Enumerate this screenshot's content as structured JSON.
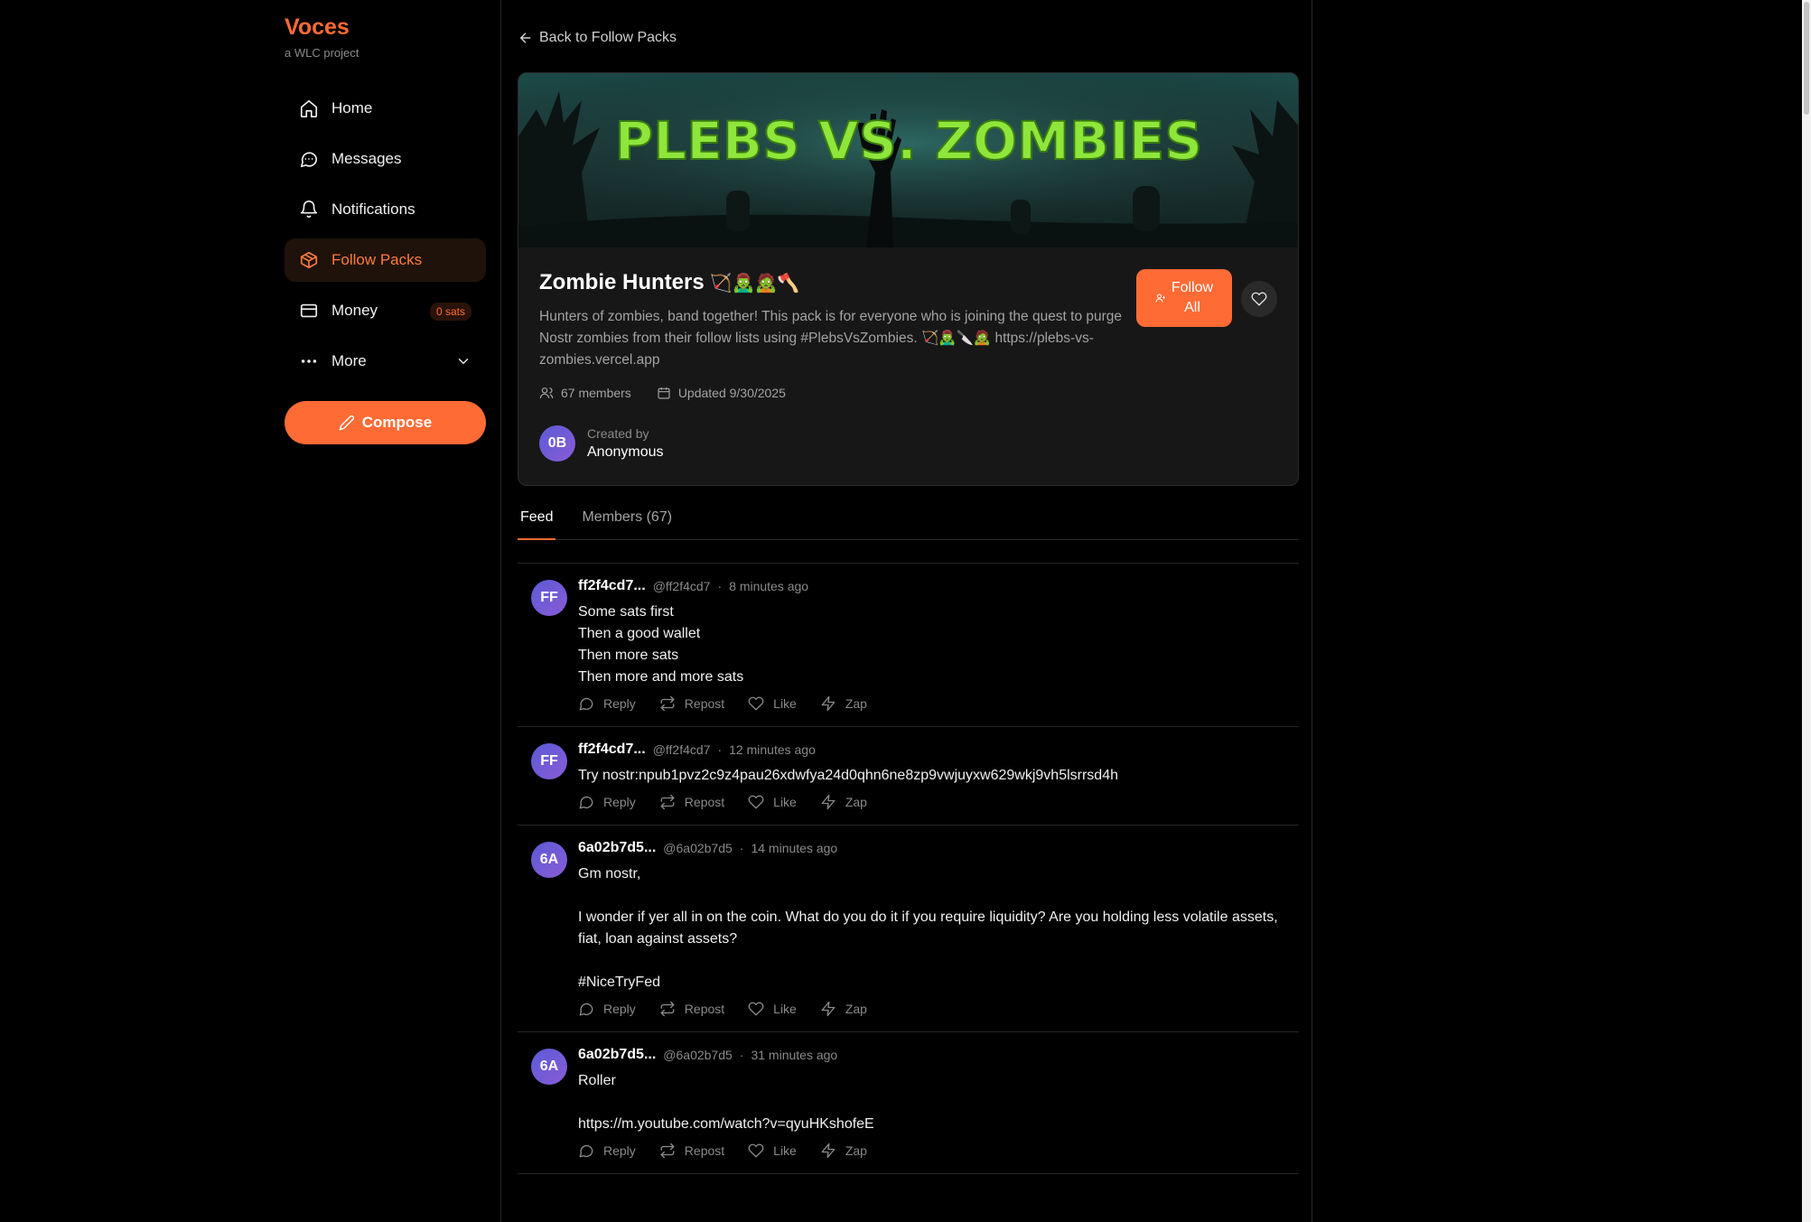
{
  "brand": {
    "title": "Voces",
    "subtitle": "a WLC project"
  },
  "nav": [
    {
      "label": "Home",
      "icon": "home-icon"
    },
    {
      "label": "Messages",
      "icon": "message-icon"
    },
    {
      "label": "Notifications",
      "icon": "bell-icon"
    },
    {
      "label": "Follow Packs",
      "icon": "package-icon",
      "active": true
    },
    {
      "label": "Money",
      "icon": "wallet-icon",
      "badge": "0 sats"
    },
    {
      "label": "More",
      "icon": "more-icon"
    }
  ],
  "compose_label": "Compose",
  "back_label": "Back to Follow Packs",
  "banner_text": "PLEBS VS. ZOMBIES",
  "pack": {
    "title": "Zombie Hunters",
    "title_emoji": "🏹🧟‍♂️🧟🪓",
    "description": "Hunters of zombies, band together! This pack is for everyone who is joining the quest to purge Nostr zombies from their follow lists using #PlebsVsZombies. 🏹🧟‍♂️🔪🧟 https://plebs-vs-zombies.vercel.app",
    "members": "67 members",
    "updated": "Updated 9/30/2025",
    "creator_label": "Created by",
    "creator_name": "Anonymous",
    "creator_initials": "0B",
    "follow_all_line1": "Follow",
    "follow_all_line2": "All"
  },
  "tabs": [
    {
      "label": "Feed",
      "active": true
    },
    {
      "label": "Members (67)"
    }
  ],
  "actions": {
    "reply": "Reply",
    "repost": "Repost",
    "like": "Like",
    "zap": "Zap"
  },
  "posts": [
    {
      "initials": "FF",
      "name": "ff2f4cd7...",
      "handle": "@ff2f4cd7",
      "time": "8 minutes ago",
      "body": "Some sats first\nThen a good wallet\nThen more sats\nThen more and more sats"
    },
    {
      "initials": "FF",
      "name": "ff2f4cd7...",
      "handle": "@ff2f4cd7",
      "time": "12 minutes ago",
      "body": "Try nostr:npub1pvz2c9z4pau26xdwfya24d0qhn6ne8zp9vwjuyxw629wkj9vh5lsrrsd4h"
    },
    {
      "initials": "6A",
      "name": "6a02b7d5...",
      "handle": "@6a02b7d5",
      "time": "14 minutes ago",
      "body": "Gm nostr,\n\nI wonder if yer all in on the coin. What do you do it if you require liquidity? Are you holding less volatile assets, fiat, loan against assets?\n\n#NiceTryFed"
    },
    {
      "initials": "6A",
      "name": "6a02b7d5...",
      "handle": "@6a02b7d5",
      "time": "31 minutes ago",
      "body": "Roller\n\nhttps://m.youtube.com/watch?v=qyuHKshofeE"
    }
  ],
  "colors": {
    "accent": "#ff6b35",
    "background": "#000000",
    "card": "#171717"
  }
}
